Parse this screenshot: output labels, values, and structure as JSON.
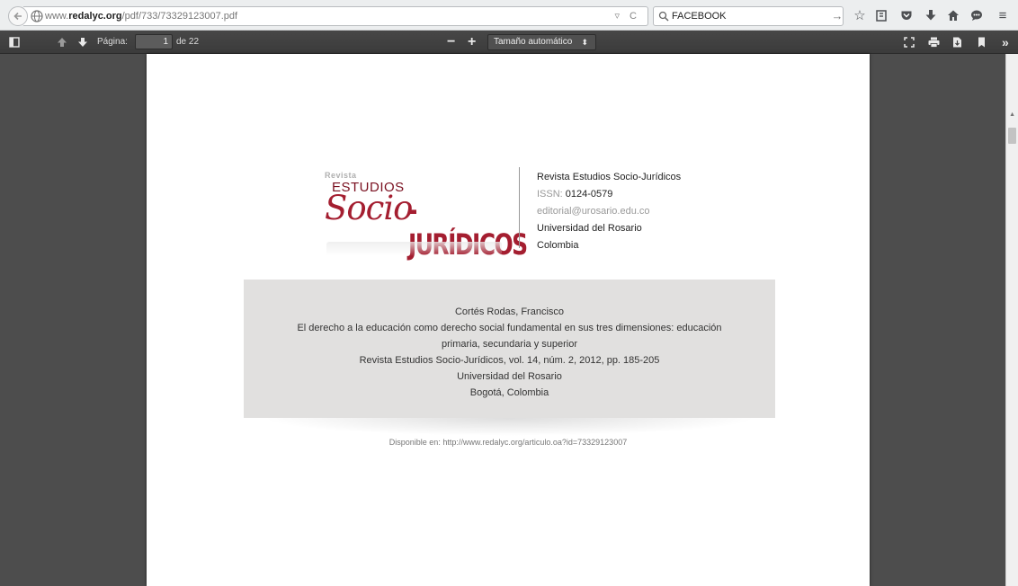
{
  "browser": {
    "url_host": "www.redalyc.org",
    "url_path": "/pdf/733/73329123007.pdf",
    "url_prefix": "www.",
    "url_domain": "redalyc.org",
    "search_value": "FACEBOOK"
  },
  "pdf_toolbar": {
    "page_label": "Página:",
    "current_page": "1",
    "page_total": "de 22",
    "zoom_value": "Tamaño automático"
  },
  "document": {
    "logo": {
      "revista": "Revista",
      "estudios": "ESTUDIOS",
      "socio": "Socio",
      "juridicos": "-JURÍDICOS"
    },
    "journal": {
      "name": "Revista Estudios Socio-Jurídicos",
      "issn_label": "ISSN:",
      "issn_value": "0124-0579",
      "email": "editorial@urosario.edu.co",
      "institution": "Universidad del Rosario",
      "country": "Colombia"
    },
    "citation": {
      "author": "Cortés Rodas, Francisco",
      "title_line1": "El derecho a la educación como derecho social fundamental en sus tres dimensiones: educación",
      "title_line2": "primaria, secundaria y superior",
      "source": "Revista Estudios Socio-Jurídicos, vol. 14, núm. 2, 2012, pp. 185-205",
      "publisher": "Universidad del Rosario",
      "place": "Bogotá, Colombia"
    },
    "available": "Disponible en: http://www.redalyc.org/articulo.oa?id=73329123007"
  },
  "colors": {
    "logo_red": "#a41e30",
    "toolbar_bg": "#3b3b3b",
    "citation_bg": "#e1e0df"
  }
}
